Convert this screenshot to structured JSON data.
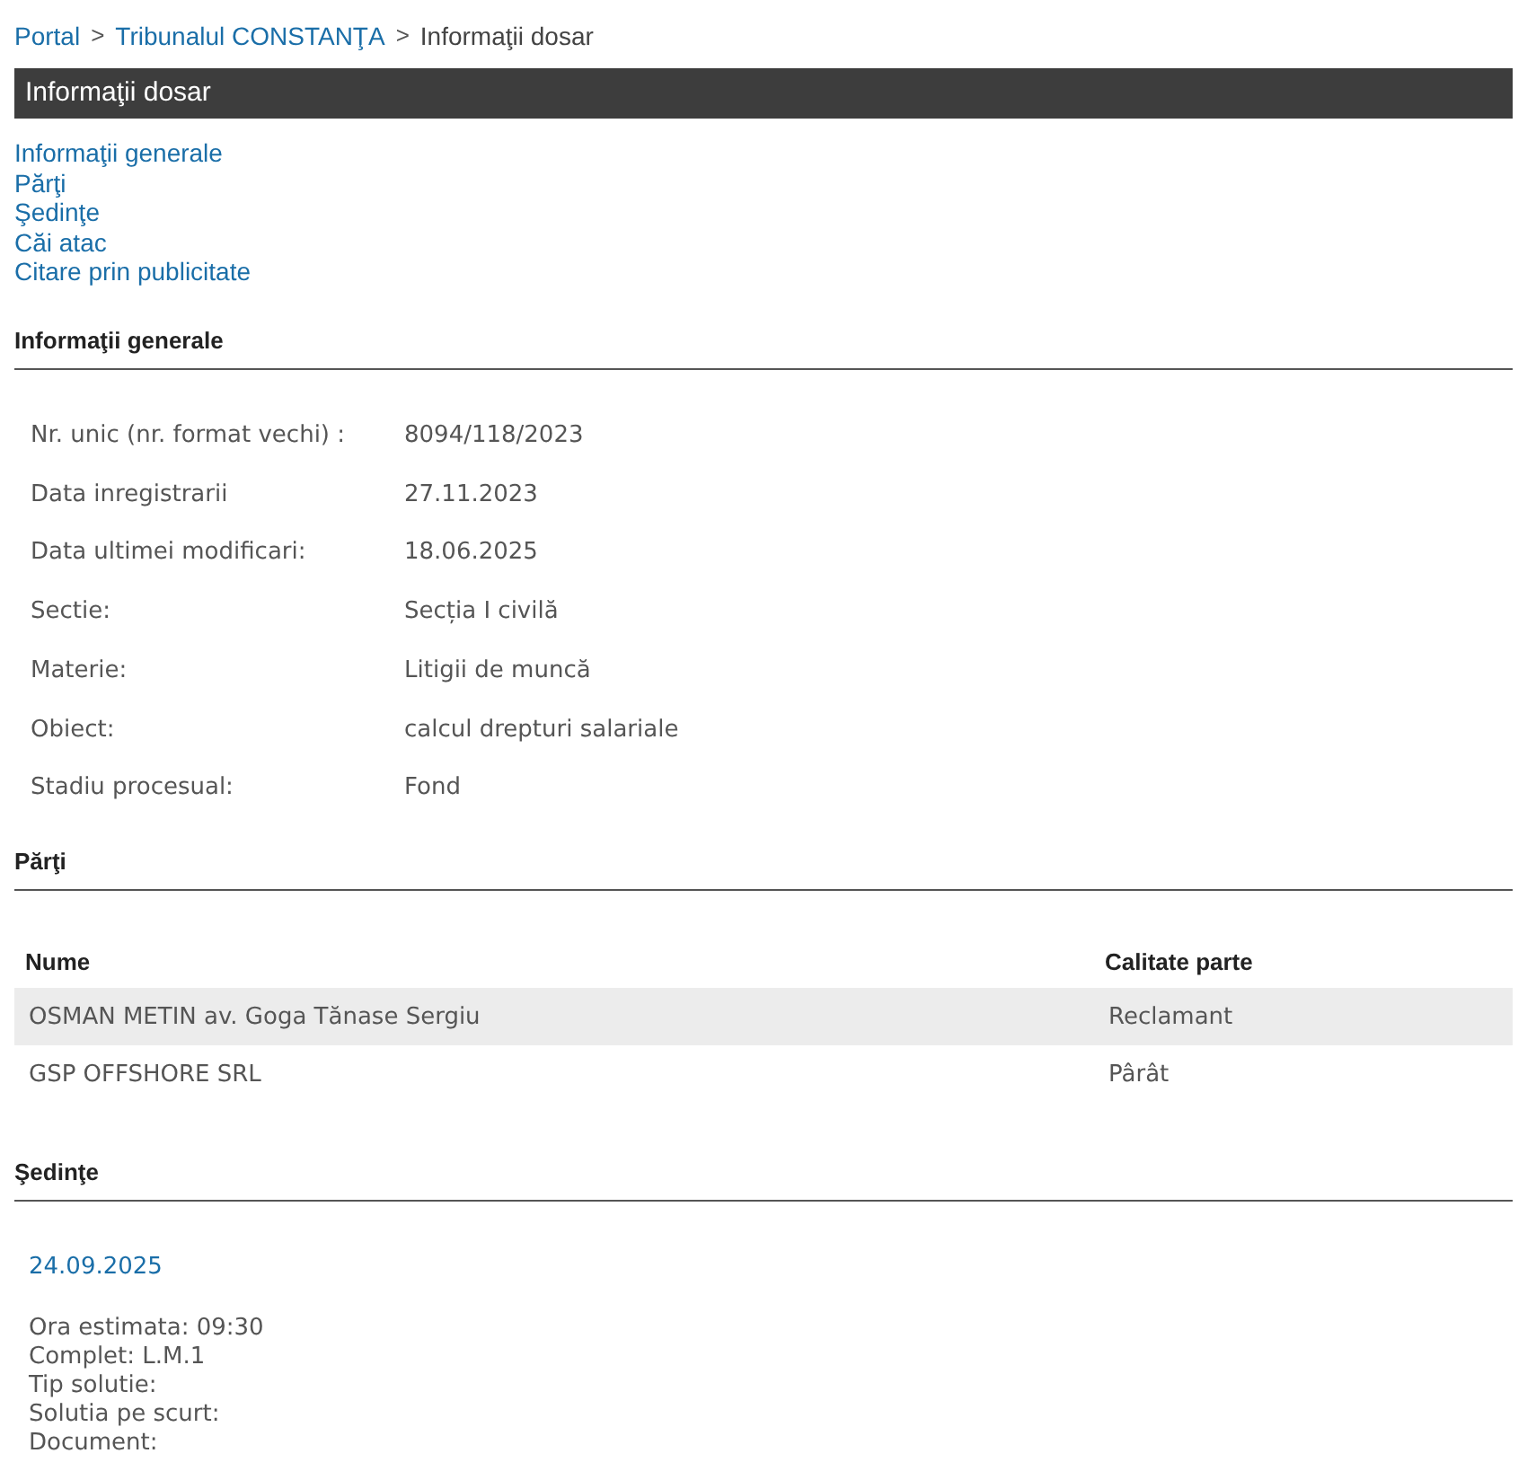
{
  "breadcrumb": [
    {
      "kind": "link",
      "label": "Portal"
    },
    {
      "kind": "separator",
      "label": ">"
    },
    {
      "kind": "link",
      "label": "Tribunalul CONSTANŢA"
    },
    {
      "kind": "separator",
      "label": ">"
    },
    {
      "kind": "current",
      "label": "Informaţii dosar"
    }
  ],
  "title_bar": {
    "title": "Informaţii dosar"
  },
  "nav_links": [
    "Informaţii generale",
    "Părţi",
    "Şedinţe",
    "Căi atac",
    "Citare prin publicitate"
  ],
  "general_info": {
    "heading": "Informaţii generale",
    "rows": [
      {
        "label": "Nr. unic (nr. format vechi) :",
        "value": "8094/118/2023"
      },
      {
        "label": "Data inregistrarii",
        "value": "27.11.2023"
      },
      {
        "label": "Data ultimei modificari:",
        "value": "18.06.2025"
      },
      {
        "label": "Sectie:",
        "value": "Secția I civilă"
      },
      {
        "label": "Materie:",
        "value": "Litigii de muncă"
      },
      {
        "label": "Obiect:",
        "value": "calcul drepturi salariale"
      },
      {
        "label": "Stadiu procesual:",
        "value": "Fond"
      }
    ]
  },
  "parties": {
    "heading": "Părţi",
    "columns": [
      "Nume",
      "Calitate parte"
    ],
    "rows": [
      {
        "name": "OSMAN METIN av. Goga Tănase Sergiu",
        "role": "Reclamant",
        "shaded": true
      },
      {
        "name": "GSP OFFSHORE SRL",
        "role": "Pârât",
        "shaded": false
      }
    ]
  },
  "hearings": {
    "heading": "Şedinţe",
    "items": [
      {
        "date": "24.09.2025",
        "details": [
          "Ora estimata: 09:30",
          "Complet: L.M.1",
          "Tip solutie:",
          "Solutia pe scurt:",
          "Document:"
        ]
      }
    ]
  }
}
